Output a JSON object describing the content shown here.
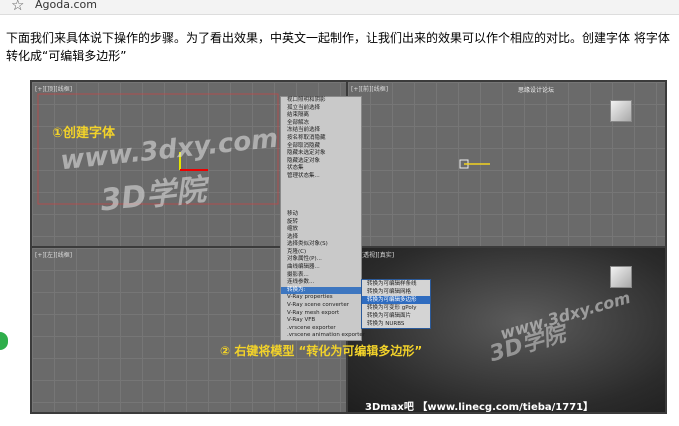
{
  "browser": {
    "bookmark_label": "Agoda.com"
  },
  "article": {
    "paragraph": "下面我们来具体说下操作的步骤。为了看出效果，中英文一起制作，让我们出来的效果可以作个相应的对比。创建字体 将字体转化成“可编辑多边形”"
  },
  "screenshot": {
    "step1_label": "①创建字体",
    "step2_label": "② 右键将模型 “转化为可编辑多边形”",
    "watermark_url": "www.3dxy.com",
    "watermark_cn": "3D学院",
    "credit": "3Dmax吧 【www.linecg.com/tieba/1771】",
    "site_watermark": "思缘设计论坛",
    "viewport_labels": [
      "[+][顶][线框]",
      "[+][前][线框]",
      "[+][左][线框]",
      "[+][透视][真实]"
    ],
    "context_menu": [
      "视口照明和阴影",
      "孤立当前选择",
      "结束隔离",
      "全部解冻",
      "冻结当前选择",
      "按名称取消隐藏",
      "全部取消隐藏",
      "隐藏未选定对象",
      "隐藏选定对象",
      "状态集",
      "管理状态集...",
      "",
      "",
      "",
      "",
      "移动",
      "旋转",
      "缩放",
      "选择",
      "选择类似对象(S)",
      "克隆(C)",
      "对象属性(P)...",
      "曲线编辑器...",
      "摄影表...",
      "连线参数...",
      "转换为:",
      "V-Ray properties",
      "V-Ray scene converter",
      "V-Ray mesh export",
      "V-Ray VFB",
      ".vrscene exporter",
      ".vrscene animation exporter"
    ],
    "submenu": [
      "转换为可编辑样条线",
      "转换为可编辑网格",
      "转换为可编辑多边形",
      "转换为可变形 gPoly",
      "转换为可编辑面片",
      "转换为 NURBS"
    ]
  }
}
